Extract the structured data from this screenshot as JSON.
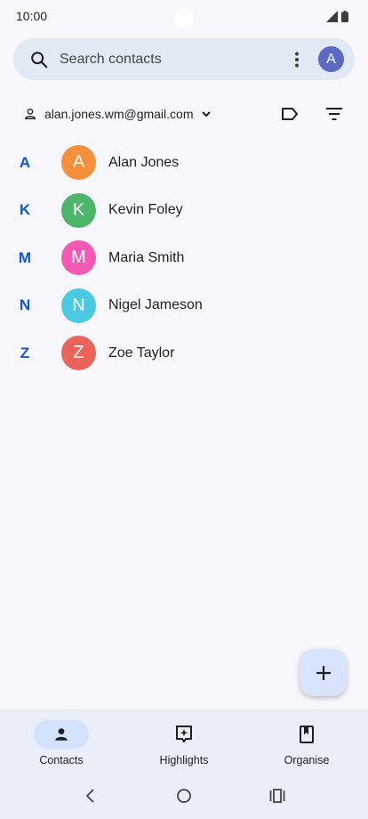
{
  "status_bar": {
    "time": "10:00"
  },
  "search": {
    "placeholder": "Search contacts",
    "account_initial": "A"
  },
  "account": {
    "email": "alan.jones.wm@gmail.com"
  },
  "contacts": [
    {
      "letter": "A",
      "initial": "A",
      "name": "Alan Jones",
      "color": "#f6903c"
    },
    {
      "letter": "K",
      "initial": "K",
      "name": "Kevin Foley",
      "color": "#4fb56b"
    },
    {
      "letter": "M",
      "initial": "M",
      "name": "Maria Smith",
      "color": "#f25ab6"
    },
    {
      "letter": "N",
      "initial": "N",
      "name": "Nigel Jameson",
      "color": "#4cc9e2"
    },
    {
      "letter": "Z",
      "initial": "Z",
      "name": "Zoe Taylor",
      "color": "#ea645c"
    }
  ],
  "bottom_nav": {
    "contacts_label": "Contacts",
    "highlights_label": "Highlights",
    "organise_label": "Organise"
  },
  "icons": {
    "search": "search-icon",
    "more": "more-vert-icon",
    "person": "person-icon",
    "chevron": "chevron-down-icon",
    "label": "label-icon",
    "filter": "filter-icon",
    "add": "add-icon"
  },
  "colors": {
    "accent": "#0b57d0",
    "search_bg": "#e1e9f4",
    "nav_bg": "#e9eef8",
    "fab_bg": "#d8e4fb"
  }
}
